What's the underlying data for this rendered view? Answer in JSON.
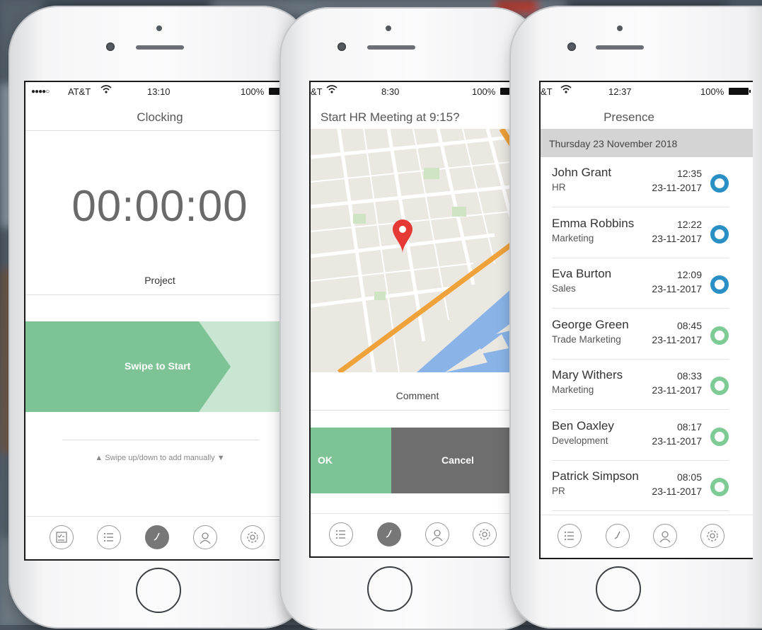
{
  "colors": {
    "accent_green": "#7ec395",
    "light_green": "#c8e6d2",
    "status_blue": "#2a8fc4",
    "status_green": "#7ecb95",
    "cancel_gray": "#6e6e6e",
    "map_pin": "#e53935"
  },
  "phones": [
    {
      "status": {
        "signal": "●●●●○",
        "carrier": "AT&T",
        "wifi_icon": "wifi-icon",
        "time": "13:10",
        "battery": "100%"
      },
      "title": "Clocking",
      "timer": "00:00:00",
      "project_label": "Project",
      "swipe_label": "Swipe to Start",
      "manual_hint": "▲ Swipe up/down to add manually ▼",
      "tabs": [
        "checklist-icon",
        "list-icon",
        "clock-icon",
        "person-icon",
        "gear-icon"
      ],
      "active_tab": "clock-icon"
    },
    {
      "status": {
        "carrier": "&T",
        "wifi_icon": "wifi-icon",
        "time": "8:30",
        "battery": "100%"
      },
      "title": "Start HR Meeting at 9:15?",
      "map_pin_icon": "location-pin-icon",
      "comment_label": "Comment",
      "ok_label": "OK",
      "cancel_label": "Cancel",
      "tabs": [
        "list-icon",
        "clock-icon",
        "person-icon",
        "gear-icon"
      ],
      "active_tab": "clock-icon"
    },
    {
      "status": {
        "carrier": "&T",
        "wifi_icon": "wifi-icon",
        "time": "12:37",
        "battery": "100%"
      },
      "title": "Presence",
      "date_band": "Thursday 23 November 2018",
      "people": [
        {
          "name": "John Grant",
          "dept": "HR",
          "time": "12:35",
          "date": "23-11-2017",
          "status": "blue"
        },
        {
          "name": "Emma Robbins",
          "dept": "Marketing",
          "time": "12:22",
          "date": "23-11-2017",
          "status": "blue"
        },
        {
          "name": "Eva Burton",
          "dept": "Sales",
          "time": "12:09",
          "date": "23-11-2017",
          "status": "blue"
        },
        {
          "name": "George Green",
          "dept": "Trade Marketing",
          "time": "08:45",
          "date": "23-11-2017",
          "status": "green"
        },
        {
          "name": "Mary Withers",
          "dept": "Marketing",
          "time": "08:33",
          "date": "23-11-2017",
          "status": "green"
        },
        {
          "name": "Ben Oaxley",
          "dept": "Development",
          "time": "08:17",
          "date": "23-11-2017",
          "status": "green"
        },
        {
          "name": "Patrick Simpson",
          "dept": "PR",
          "time": "08:05",
          "date": "23-11-2017",
          "status": "green"
        }
      ],
      "tabs": [
        "list-icon",
        "clock-icon",
        "person-icon",
        "gear-icon"
      ]
    }
  ]
}
